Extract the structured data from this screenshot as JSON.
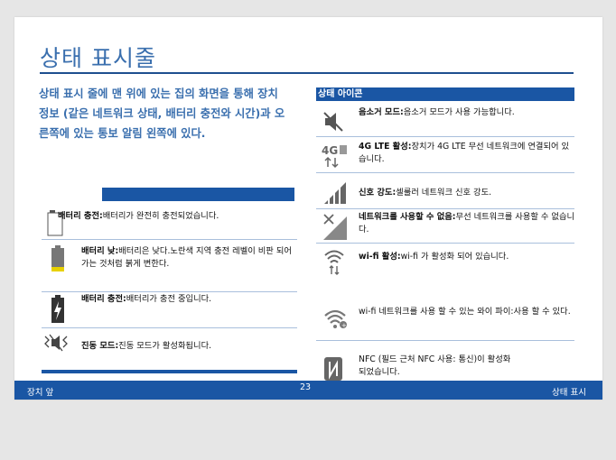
{
  "title": "상태 표시줄",
  "intro": "상태 표시 줄에 맨 위에 있는 집의 화면을 통해 장치 정보 (같은 네트워크 상태, 배터리 충전와 시간)과 오른쪽에 있는 통보 알림 왼쪽에 있다.",
  "left_rows": [
    {
      "icon": "battery-full-icon",
      "label": "배터리 충전:",
      "text": "배터리가 완전히 충전되었습니다."
    },
    {
      "icon": "battery-low-icon",
      "label": "배터리 낮:",
      "text": "배터리은 낮다.노란색 지역 충전 레벨이 비판 되어 가는 것처럼 붉게 변한다."
    },
    {
      "icon": "battery-charging-icon",
      "label": "배터리 충전:",
      "text": "배터리가 충전 중입니다."
    },
    {
      "icon": "vibrate-icon",
      "label": "진동 모드:",
      "text": "진동 모드가 활성화됩니다."
    }
  ],
  "right_header": "상태 아이콘",
  "right_rows": [
    {
      "icon": "speaker-mute-icon",
      "label": "음소거 모드:",
      "text": "음소거 모드가 사용 가능합니다."
    },
    {
      "icon": "lte-icon",
      "label": "4G LTE 활성:",
      "text": "장치가 4G LTE 무선 네트워크에 연결되어 있습니다.",
      "icon_text": "4G"
    },
    {
      "icon": "signal-strength-icon",
      "label": "신호 강도:",
      "text": "셀룰러 네트워크 신호 강도."
    },
    {
      "icon": "no-network-icon",
      "label": "네트워크를 사용할 수 없음:",
      "text": "무선 네트워크를 사용할 수 없습니다."
    },
    {
      "icon": "wifi-active-icon",
      "label": "wi-fi 활성:",
      "text": "wi-fi 가 활성화 되어 있습니다."
    },
    {
      "icon": "wifi-available-icon",
      "label": "",
      "text": "wi-fi 네트워크를 사용 할 수 있는 와이 파이:사용 할 수 있다."
    },
    {
      "icon": "nfc-icon",
      "label": "",
      "text": "NFC (필드 근처 NFC 사용: 통신)이 활성화 되었습니다."
    }
  ],
  "footer": {
    "left": "장치 앞",
    "page": "23",
    "right": "상태 표시"
  },
  "colors": {
    "accent": "#1a56a4",
    "title": "#3a6fae"
  }
}
